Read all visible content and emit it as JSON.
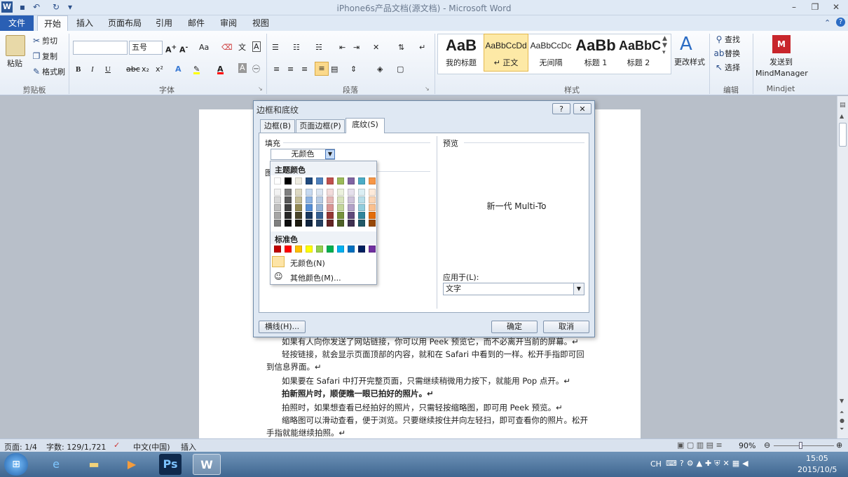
{
  "window": {
    "title": "iPhone6s产品文档(源文档) - Microsoft Word"
  },
  "quick_access": {
    "icons": [
      "word-icon",
      "save-icon",
      "undo-icon",
      "redo-icon",
      "customize-icon"
    ]
  },
  "tabs": [
    "文件",
    "开始",
    "插入",
    "页面布局",
    "引用",
    "邮件",
    "审阅",
    "视图"
  ],
  "ribbon": {
    "clipboard": {
      "paste": "粘贴",
      "cut": "剪切",
      "copy": "复制",
      "format_painter": "格式刷",
      "label": "剪贴板"
    },
    "font": {
      "font_name": "",
      "font_size": "五号",
      "label": "字体",
      "font_format": "Aa"
    },
    "paragraph": {
      "label": "段落"
    },
    "styles": {
      "items": [
        {
          "preview": "AaB",
          "name": "我的标题"
        },
        {
          "preview": "AaBbCcDd",
          "name": "↵ 正文"
        },
        {
          "preview": "AaBbCcDc",
          "name": "无间隔"
        },
        {
          "preview": "AaBb",
          "name": "标题 1"
        },
        {
          "preview": "AaBbC",
          "name": "标题 2"
        }
      ],
      "change": "更改样式",
      "label": "样式"
    },
    "editing": {
      "find": "查找",
      "replace": "替换",
      "select": "选择",
      "label": "编辑"
    },
    "mindjet": {
      "send": "发送到",
      "target": "MindManager",
      "label": "Mindjet"
    }
  },
  "document": {
    "lines": [
      "如果有人向你发送了网站链接，你可以用 Peek 预览它，而不必离开当前的屏幕。↵",
      "轻按链接，就会显示页面顶部的内容，就和在 Safari 中看到的一样。松开手指即可回",
      "到信息界面。↵",
      "如果要在 Safari 中打开完整页面，只需继续稍微用力按下，就能用 Pop 点开。↵",
      "拍新照片时，顺便瞧一眼已拍好的照片。↵",
      "拍照时，如果想查看已经拍好的照片，只需轻按缩略图，即可用 Peek 预览。↵",
      "缩略图可以滑动查看，便于浏览。只要继续按住并向左轻扫，即可查看你的照片。松开",
      "手指就能继续拍照。↵"
    ]
  },
  "dialog": {
    "title": "边框和底纹",
    "help": "?",
    "close": "✕",
    "tabs": [
      "边框(B)",
      "页面边框(P)",
      "底纹(S)"
    ],
    "fill_label": "填充",
    "fill_value": "无颜色",
    "pattern_label_partial": "图",
    "preview_label": "预览",
    "preview_text": "新一代 Multi-To",
    "apply_to_label": "应用于(L):",
    "apply_to_value": "文字",
    "horizontal_line": "横线(H)...",
    "ok": "确定",
    "cancel": "取消"
  },
  "color_picker": {
    "theme_label": "主题颜色",
    "standard_label": "标准色",
    "no_color": "无颜色(N)",
    "more_colors": "其他颜色(M)...",
    "theme_top": [
      "#ffffff",
      "#000000",
      "#eeece1",
      "#1f497d",
      "#4f81bd",
      "#c0504d",
      "#9bbb59",
      "#8064a2",
      "#4bacc6",
      "#f79646"
    ],
    "theme_shades": [
      [
        "#f2f2f2",
        "#7f7f7f",
        "#ddd9c3",
        "#c6d9f0",
        "#dbe5f1",
        "#f2dcdb",
        "#ebf1dd",
        "#e5e0ec",
        "#dbeef3",
        "#fdeada"
      ],
      [
        "#d8d8d8",
        "#595959",
        "#c4bd97",
        "#8db3e2",
        "#b8cce4",
        "#e5b9b7",
        "#d7e3bc",
        "#ccc1d9",
        "#b7dde8",
        "#fbd5b5"
      ],
      [
        "#bfbfbf",
        "#3f3f3f",
        "#938953",
        "#548dd4",
        "#95b3d7",
        "#d99694",
        "#c3d69b",
        "#b2a2c7",
        "#92cddc",
        "#fac08f"
      ],
      [
        "#a5a5a5",
        "#262626",
        "#494429",
        "#17365d",
        "#366092",
        "#953734",
        "#76923c",
        "#5f497a",
        "#31859b",
        "#e36c09"
      ],
      [
        "#7f7f7f",
        "#0c0c0c",
        "#1d1b10",
        "#0f243e",
        "#244061",
        "#632423",
        "#4f6128",
        "#3f3151",
        "#205867",
        "#974806"
      ]
    ],
    "standard": [
      "#c00000",
      "#ff0000",
      "#ffc000",
      "#ffff00",
      "#92d050",
      "#00b050",
      "#00b0f0",
      "#0070c0",
      "#002060",
      "#7030a0"
    ]
  },
  "status_bar": {
    "page": "页面: 1/4",
    "words": "字数: 129/1,721",
    "language": "中文(中国)",
    "mode": "插入",
    "zoom": "90%"
  },
  "taskbar": {
    "apps": [
      "start-orb-icon",
      "ie-icon",
      "explorer-icon",
      "media-icon",
      "photoshop-icon",
      "word-icon"
    ],
    "ime": "CH",
    "time": "15:05",
    "date": "2015/10/5"
  }
}
